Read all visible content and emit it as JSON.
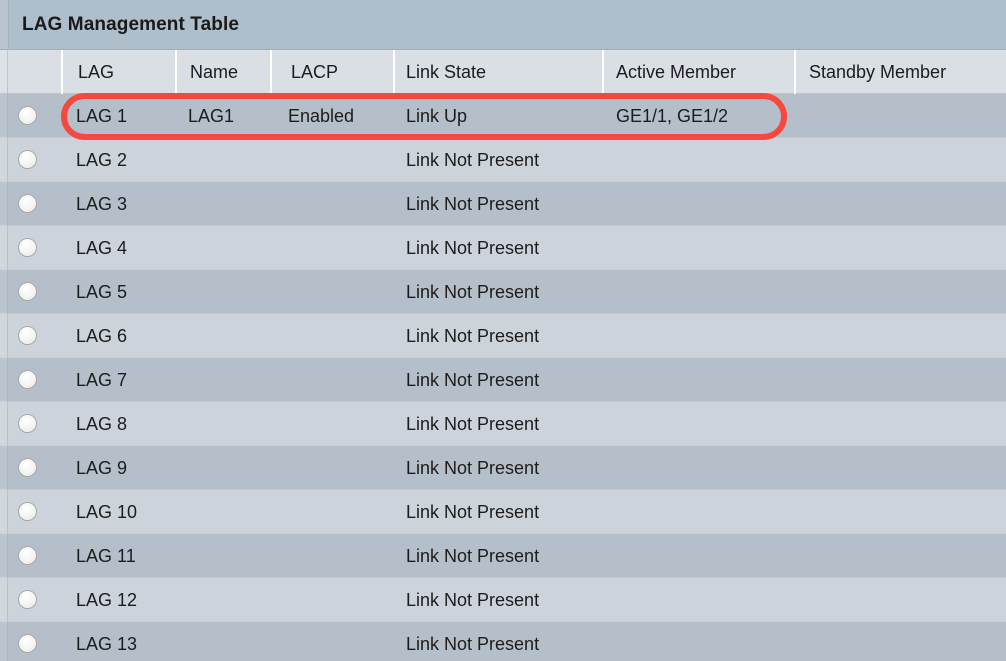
{
  "panel": {
    "title": "LAG Management Table"
  },
  "table": {
    "columns": [
      {
        "key": "select",
        "label": ""
      },
      {
        "key": "lag",
        "label": "LAG"
      },
      {
        "key": "name",
        "label": "Name"
      },
      {
        "key": "lacp",
        "label": "LACP"
      },
      {
        "key": "link",
        "label": "Link State"
      },
      {
        "key": "active",
        "label": "Active Member"
      },
      {
        "key": "standby",
        "label": "Standby Member"
      }
    ],
    "rows": [
      {
        "lag": "LAG 1",
        "name": "LAG1",
        "lacp": "Enabled",
        "link": "Link Up",
        "active": "GE1/1, GE1/2",
        "standby": "",
        "selected": false,
        "highlighted": true
      },
      {
        "lag": "LAG 2",
        "name": "",
        "lacp": "",
        "link": "Link Not Present",
        "active": "",
        "standby": "",
        "selected": false,
        "highlighted": false
      },
      {
        "lag": "LAG 3",
        "name": "",
        "lacp": "",
        "link": "Link Not Present",
        "active": "",
        "standby": "",
        "selected": false,
        "highlighted": false
      },
      {
        "lag": "LAG 4",
        "name": "",
        "lacp": "",
        "link": "Link Not Present",
        "active": "",
        "standby": "",
        "selected": false,
        "highlighted": false
      },
      {
        "lag": "LAG 5",
        "name": "",
        "lacp": "",
        "link": "Link Not Present",
        "active": "",
        "standby": "",
        "selected": false,
        "highlighted": false
      },
      {
        "lag": "LAG 6",
        "name": "",
        "lacp": "",
        "link": "Link Not Present",
        "active": "",
        "standby": "",
        "selected": false,
        "highlighted": false
      },
      {
        "lag": "LAG 7",
        "name": "",
        "lacp": "",
        "link": "Link Not Present",
        "active": "",
        "standby": "",
        "selected": false,
        "highlighted": false
      },
      {
        "lag": "LAG 8",
        "name": "",
        "lacp": "",
        "link": "Link Not Present",
        "active": "",
        "standby": "",
        "selected": false,
        "highlighted": false
      },
      {
        "lag": "LAG 9",
        "name": "",
        "lacp": "",
        "link": "Link Not Present",
        "active": "",
        "standby": "",
        "selected": false,
        "highlighted": false
      },
      {
        "lag": "LAG 10",
        "name": "",
        "lacp": "",
        "link": "Link Not Present",
        "active": "",
        "standby": "",
        "selected": false,
        "highlighted": false
      },
      {
        "lag": "LAG 11",
        "name": "",
        "lacp": "",
        "link": "Link Not Present",
        "active": "",
        "standby": "",
        "selected": false,
        "highlighted": false
      },
      {
        "lag": "LAG 12",
        "name": "",
        "lacp": "",
        "link": "Link Not Present",
        "active": "",
        "standby": "",
        "selected": false,
        "highlighted": false
      },
      {
        "lag": "LAG 13",
        "name": "",
        "lacp": "",
        "link": "Link Not Present",
        "active": "",
        "standby": "",
        "selected": false,
        "highlighted": false
      }
    ]
  },
  "annotation": {
    "type": "oval-highlight",
    "target_row": "LAG 1",
    "color": "#f7483f"
  },
  "colors": {
    "title_bar": "#aebecb",
    "header_bg": "#d9dfe5",
    "row_odd": "#b4bfc9",
    "row_even": "#ccd3da",
    "text": "#1c1c1c",
    "annotation": "#f7483f"
  }
}
